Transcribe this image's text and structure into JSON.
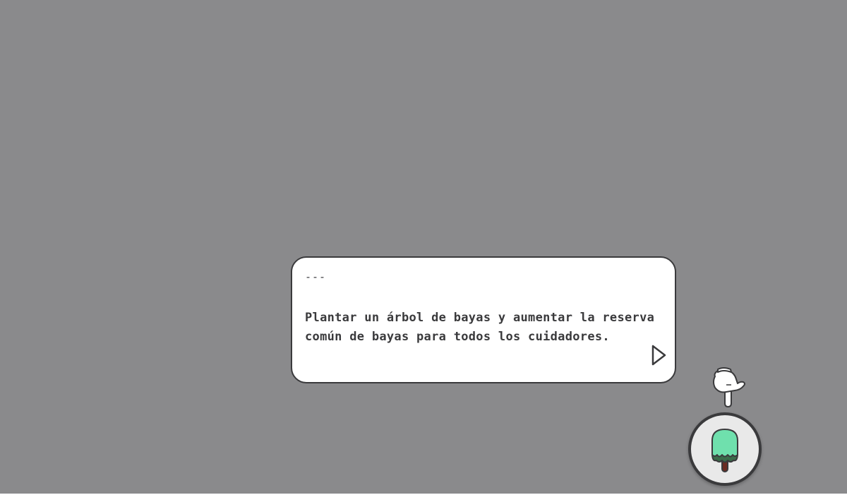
{
  "dialog": {
    "speaker": "---",
    "message": "Plantar un árbol de bayas y aumentar la reserva común de bayas para todos los cuidadores.",
    "next_icon": "play-triangle-icon"
  },
  "tutorial": {
    "pointer_icon": "pointing-hand-icon"
  },
  "action": {
    "icon": "berry-tree-icon"
  },
  "colors": {
    "background": "#8a8a8c",
    "outline": "#3a3a3c",
    "tree_foliage": "#6fe0ad",
    "tree_trunk": "#6b2b22"
  }
}
